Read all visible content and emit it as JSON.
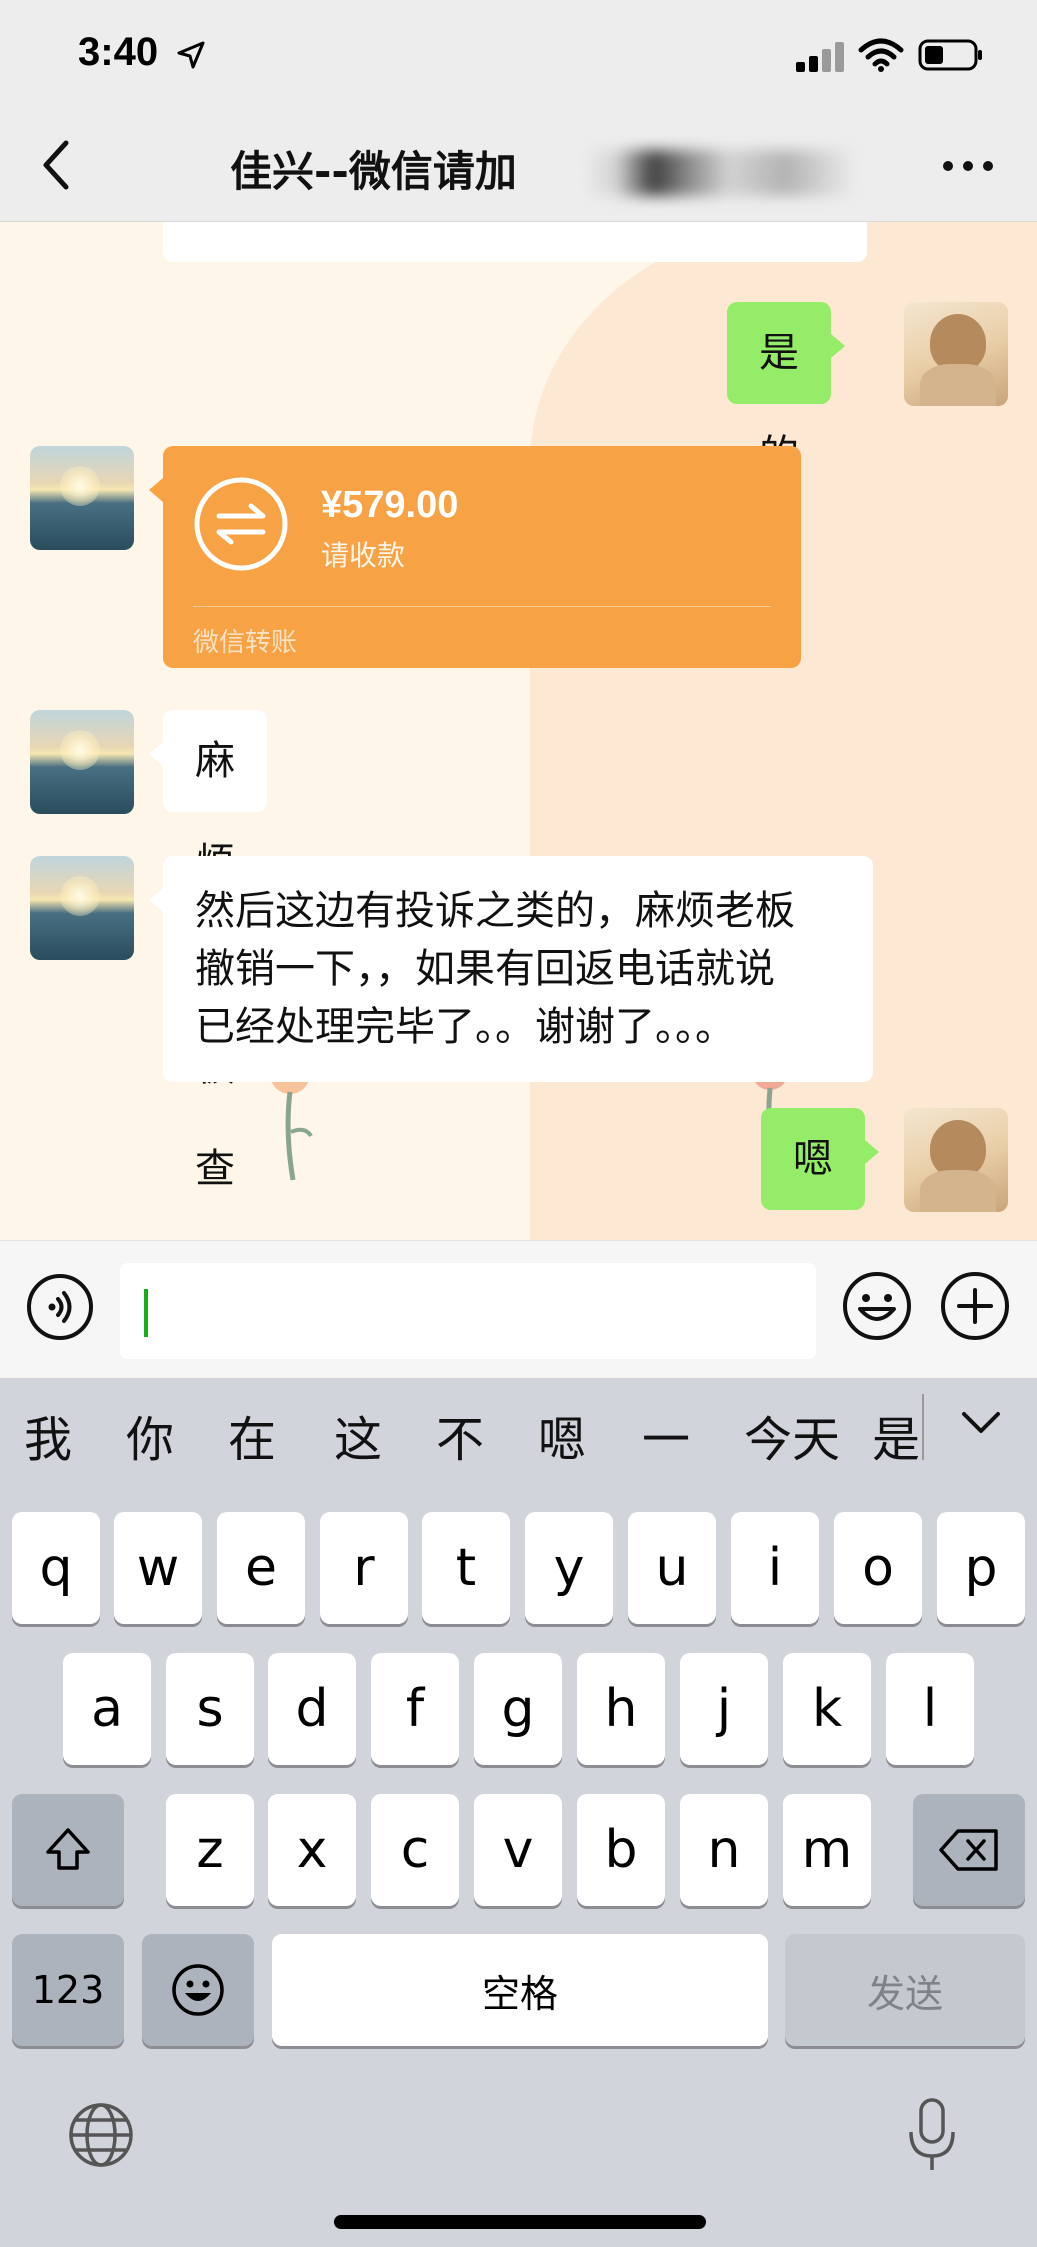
{
  "status_bar": {
    "time": "3:40",
    "icons": [
      "location-arrow-icon",
      "cellular-signal-icon",
      "wifi-icon",
      "battery-icon"
    ]
  },
  "nav": {
    "title": "佳兴--微信请加",
    "icons": [
      "back-chevron-icon",
      "more-dots-icon"
    ]
  },
  "messages": [
    {
      "side": "right",
      "type": "text",
      "text": "是的"
    },
    {
      "side": "left",
      "type": "transfer",
      "amount": "¥579.00",
      "status": "请收款",
      "footer": "微信转账"
    },
    {
      "side": "left",
      "type": "text",
      "text": "麻烦老板查收一下"
    },
    {
      "side": "left",
      "type": "text",
      "lines": [
        "然后这边有投诉之类的，麻烦老板",
        "撤销一下，，如果有回返电话就说",
        "已经处理完毕了。。谢谢了。。。"
      ]
    },
    {
      "side": "right",
      "type": "text",
      "text": "嗯"
    }
  ],
  "input_bar": {
    "value": "",
    "icons": [
      "voice-icon",
      "emoji-icon",
      "plus-icon"
    ]
  },
  "keyboard": {
    "candidates": [
      "我",
      "你",
      "在",
      "这",
      "不",
      "嗯",
      "一",
      "今天",
      "是"
    ],
    "row1": [
      "q",
      "w",
      "e",
      "r",
      "t",
      "y",
      "u",
      "i",
      "o",
      "p"
    ],
    "row2": [
      "a",
      "s",
      "d",
      "f",
      "g",
      "h",
      "j",
      "k",
      "l"
    ],
    "row3": [
      "z",
      "x",
      "c",
      "v",
      "b",
      "n",
      "m"
    ],
    "numbers_key": "123",
    "space_key": "空格",
    "send_key": "发送",
    "icons": [
      "shift-icon",
      "backspace-icon",
      "emoji-key-icon",
      "globe-icon",
      "microphone-icon",
      "chevron-down-icon"
    ]
  },
  "colors": {
    "chat_bg": "#fdf6e9",
    "green_bubble": "#95ec69",
    "transfer_orange": "#f7a244",
    "cursor": "#1aad19"
  }
}
